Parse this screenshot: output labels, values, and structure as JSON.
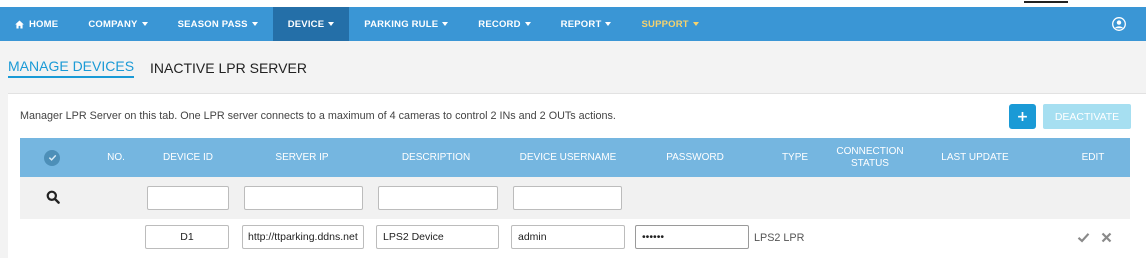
{
  "nav": {
    "items": [
      {
        "label": "HOME",
        "icon": "home-icon",
        "caret": false,
        "active": false
      },
      {
        "label": "COMPANY",
        "caret": true,
        "active": false
      },
      {
        "label": "SEASON PASS",
        "caret": true,
        "active": false
      },
      {
        "label": "DEVICE",
        "caret": true,
        "active": true
      },
      {
        "label": "PARKING RULE",
        "caret": true,
        "active": false
      },
      {
        "label": "RECORD",
        "caret": true,
        "active": false
      },
      {
        "label": "REPORT",
        "caret": true,
        "active": false
      },
      {
        "label": "SUPPORT",
        "caret": true,
        "active": false
      }
    ],
    "user_icon": "user-circle-icon"
  },
  "tabs": [
    {
      "label": "MANAGE DEVICES",
      "active": true
    },
    {
      "label": "INACTIVE LPR SERVER",
      "active": false
    }
  ],
  "page": {
    "info": "Manager LPR Server on this tab. One LPR server connects to a maximum of 4 cameras to control 2 INs and 2 OUTs actions.",
    "add_button": "+",
    "deactivate_button": "DEACTIVATE"
  },
  "table": {
    "headers": {
      "no": "NO.",
      "device_id": "DEVICE ID",
      "server_ip": "SERVER IP",
      "description": "DESCRIPTION",
      "username": "DEVICE USERNAME",
      "password": "PASSWORD",
      "type": "TYPE",
      "connection_status": "CONNECTION STATUS",
      "last_update": "LAST UPDATE",
      "edit": "EDIT"
    },
    "filters": {
      "device_id": "",
      "server_ip": "",
      "description": "",
      "username": ""
    },
    "rows": [
      {
        "device_id": "D1",
        "server_ip": "http://ttparking.ddns.net",
        "description": "LPS2 Device",
        "username": "admin",
        "password": "••••••",
        "type": "LPS2 LPR"
      }
    ]
  },
  "colors": {
    "navbar": "#3a96d5",
    "nav_active": "#246fa8",
    "support_text": "#f5d26e",
    "accent": "#1a9ad6",
    "table_header": "#75b6e0",
    "deactivate_disabled": "#a6dff1"
  }
}
